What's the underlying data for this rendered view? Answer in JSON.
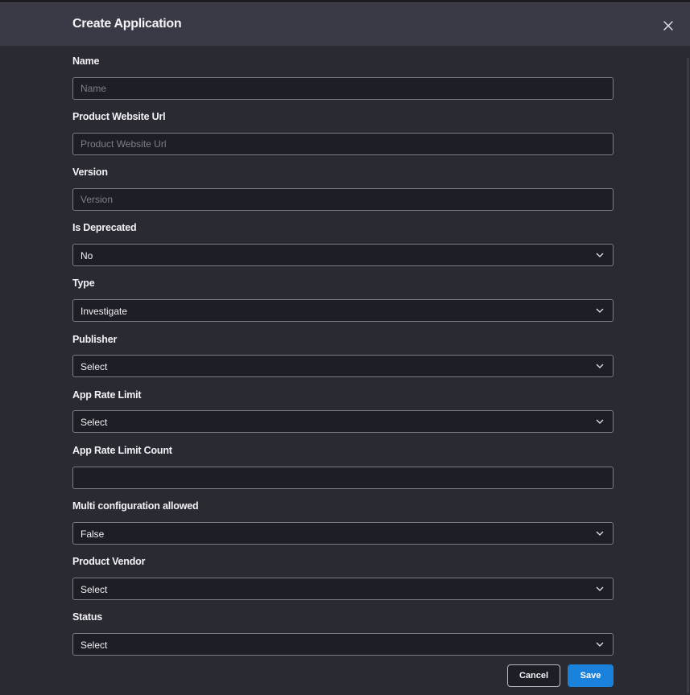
{
  "dialog": {
    "title": "Create Application",
    "close_icon": "close-icon"
  },
  "fields": {
    "name": {
      "label": "Name",
      "placeholder": "Name",
      "value": ""
    },
    "product_website_url": {
      "label": "Product Website Url",
      "placeholder": "Product Website Url",
      "value": ""
    },
    "version": {
      "label": "Version",
      "placeholder": "Version",
      "value": ""
    },
    "is_deprecated": {
      "label": "Is Deprecated",
      "value": "No"
    },
    "type": {
      "label": "Type",
      "value": "Investigate"
    },
    "publisher": {
      "label": "Publisher",
      "value": "Select"
    },
    "app_rate_limit": {
      "label": "App Rate Limit",
      "value": "Select"
    },
    "app_rate_limit_count": {
      "label": "App Rate Limit Count",
      "value": ""
    },
    "multi_configuration_allowed": {
      "label": "Multi configuration allowed",
      "value": "False"
    },
    "product_vendor": {
      "label": "Product Vendor",
      "value": "Select"
    },
    "status": {
      "label": "Status",
      "value": "Select"
    }
  },
  "buttons": {
    "cancel": "Cancel",
    "save": "Save"
  },
  "colors": {
    "background": "#2a2a33",
    "header": "#3a3a47",
    "input_bg": "#1e1e26",
    "input_border": "#7d7d88",
    "primary": "#1a82dd"
  }
}
